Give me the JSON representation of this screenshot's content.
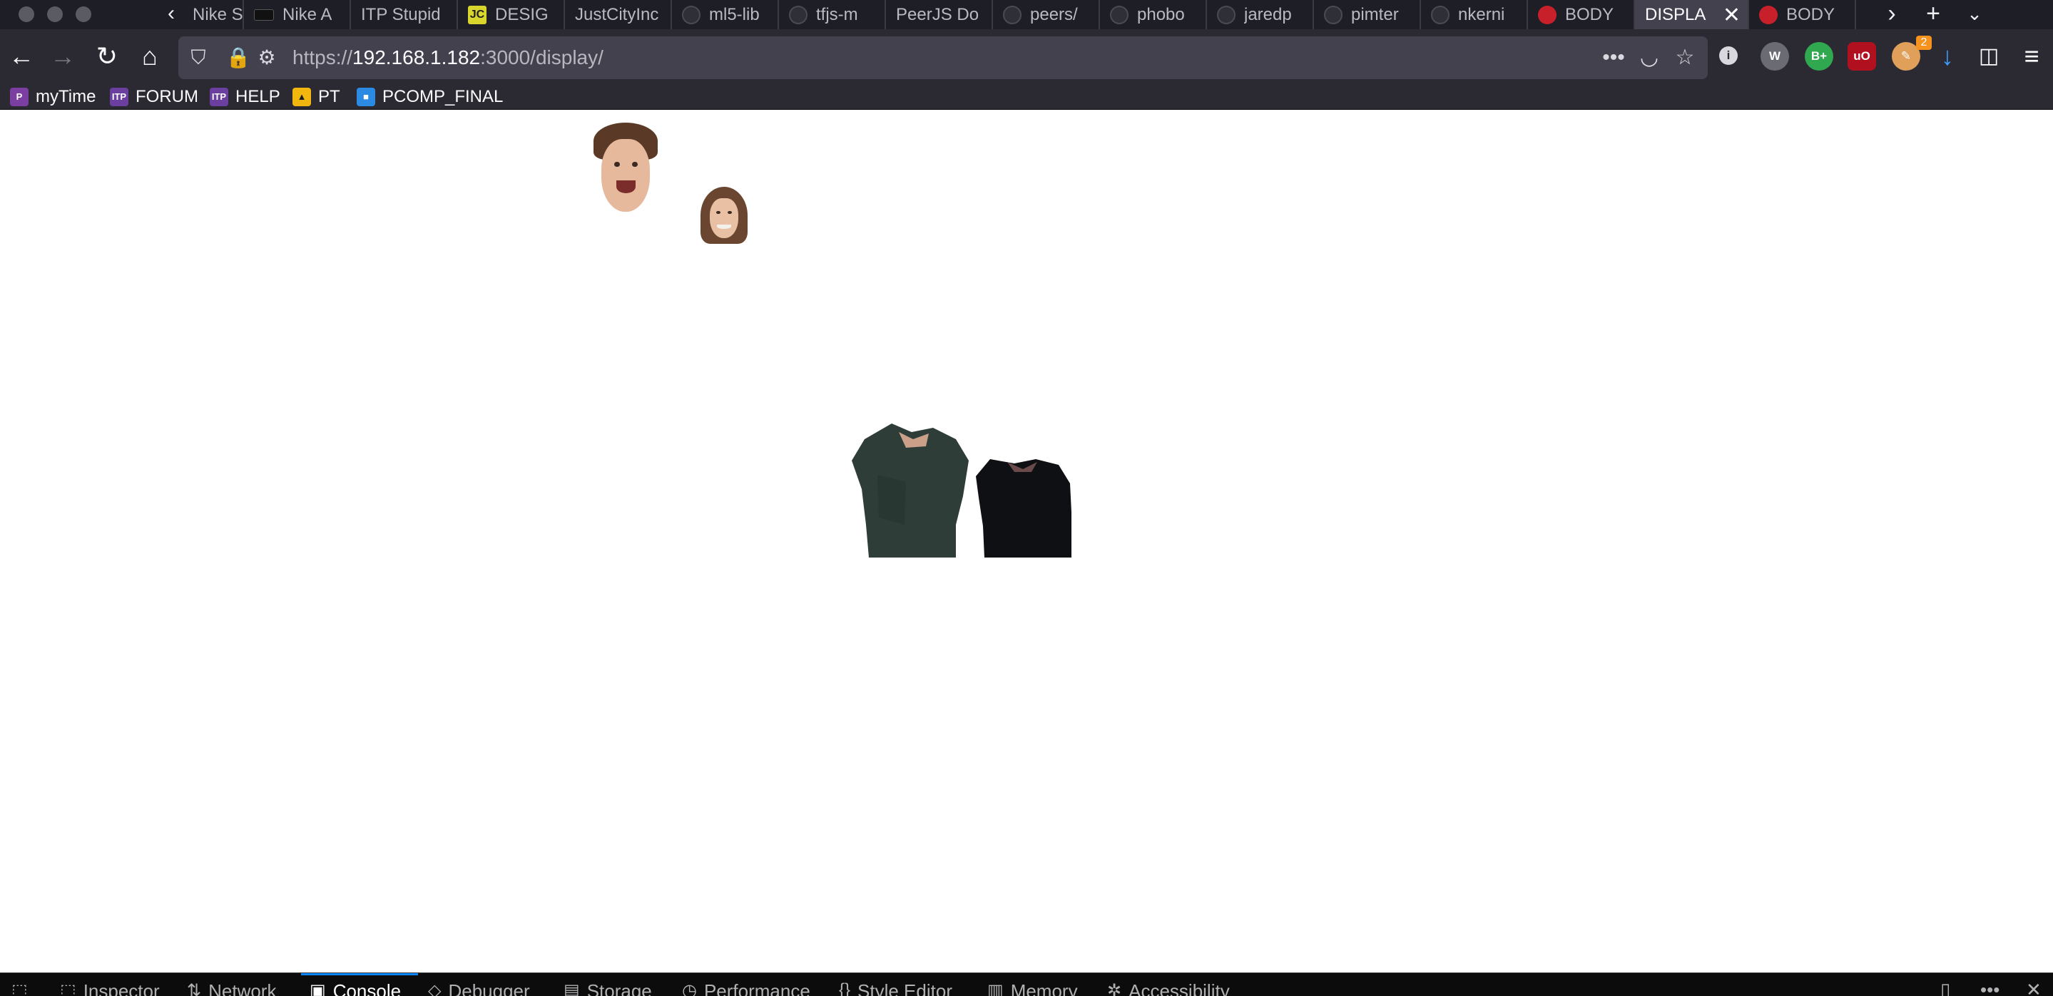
{
  "browser": {
    "tabs": [
      {
        "label": "Nike S",
        "favicon": "nike-icon",
        "active": false
      },
      {
        "label": "Nike A",
        "favicon": "nike-icon",
        "active": false
      },
      {
        "label": "ITP Stupid",
        "favicon": "",
        "active": false
      },
      {
        "label": "DESIG",
        "favicon": "jc-icon",
        "active": false
      },
      {
        "label": "JustCityInc",
        "favicon": "",
        "active": false
      },
      {
        "label": "ml5-lib",
        "favicon": "github-icon",
        "active": false
      },
      {
        "label": "tfjs-m",
        "favicon": "github-icon",
        "active": false
      },
      {
        "label": "PeerJS Do",
        "favicon": "",
        "active": false
      },
      {
        "label": "peers/",
        "favicon": "github-icon",
        "active": false
      },
      {
        "label": "phobo",
        "favicon": "github-icon",
        "active": false
      },
      {
        "label": "jaredp",
        "favicon": "github-icon",
        "active": false
      },
      {
        "label": "pimter",
        "favicon": "github-icon",
        "active": false
      },
      {
        "label": "nkerni",
        "favicon": "github-icon",
        "active": false
      },
      {
        "label": "BODY",
        "favicon": "globe-red-icon",
        "active": false
      },
      {
        "label": "DISPLA",
        "favicon": "",
        "active": true
      },
      {
        "label": "BODY",
        "favicon": "globe-red-icon",
        "active": false
      }
    ],
    "url": {
      "scheme": "https://",
      "host": "192.168.1.182",
      "rest": ":3000/display/"
    },
    "bookmarks": [
      {
        "label": "myTime",
        "icon": "mytime-icon",
        "color": "#7a3fa0"
      },
      {
        "label": "FORUM",
        "icon": "itp-icon",
        "color": "#6b3fa0"
      },
      {
        "label": "HELP",
        "icon": "itp-icon",
        "color": "#6b3fa0"
      },
      {
        "label": "PT",
        "icon": "pt-icon",
        "color": "#f2b70f"
      },
      {
        "label": "PCOMP_FINAL",
        "icon": "box-icon",
        "color": "#2b8ae2"
      }
    ],
    "extension_badge": "2",
    "extensions": [
      {
        "name": "info-extension-icon",
        "label": "i",
        "color": "#d8d8de"
      },
      {
        "name": "w-extension-icon",
        "label": "W",
        "color": "#6b6b73"
      },
      {
        "name": "b-plus-extension-icon",
        "label": "B+",
        "color": "#2fa84f"
      },
      {
        "name": "ublock-extension-icon",
        "label": "uO",
        "color": "#b1101e"
      }
    ]
  },
  "devtools": {
    "tabs": [
      {
        "label": "Inspector",
        "icon": "inspector-icon",
        "active": false
      },
      {
        "label": "Network",
        "icon": "network-icon",
        "active": false
      },
      {
        "label": "Console",
        "icon": "console-icon",
        "active": true
      },
      {
        "label": "Debugger",
        "icon": "debugger-icon",
        "active": false
      },
      {
        "label": "Storage",
        "icon": "storage-icon",
        "active": false
      },
      {
        "label": "Performance",
        "icon": "performance-icon",
        "active": false
      },
      {
        "label": "Style Editor",
        "icon": "style-editor-icon",
        "active": false
      },
      {
        "label": "Memory",
        "icon": "memory-icon",
        "active": false
      },
      {
        "label": "Accessibility",
        "icon": "accessibility-icon",
        "active": false
      }
    ]
  },
  "colors": {
    "tabstrip_bg": "#1e1e26",
    "toolbar_bg": "#2b2a33",
    "urlbar_bg": "#42414d",
    "active_tab_bg": "#42414d",
    "devtools_accent": "#0a84ff"
  }
}
